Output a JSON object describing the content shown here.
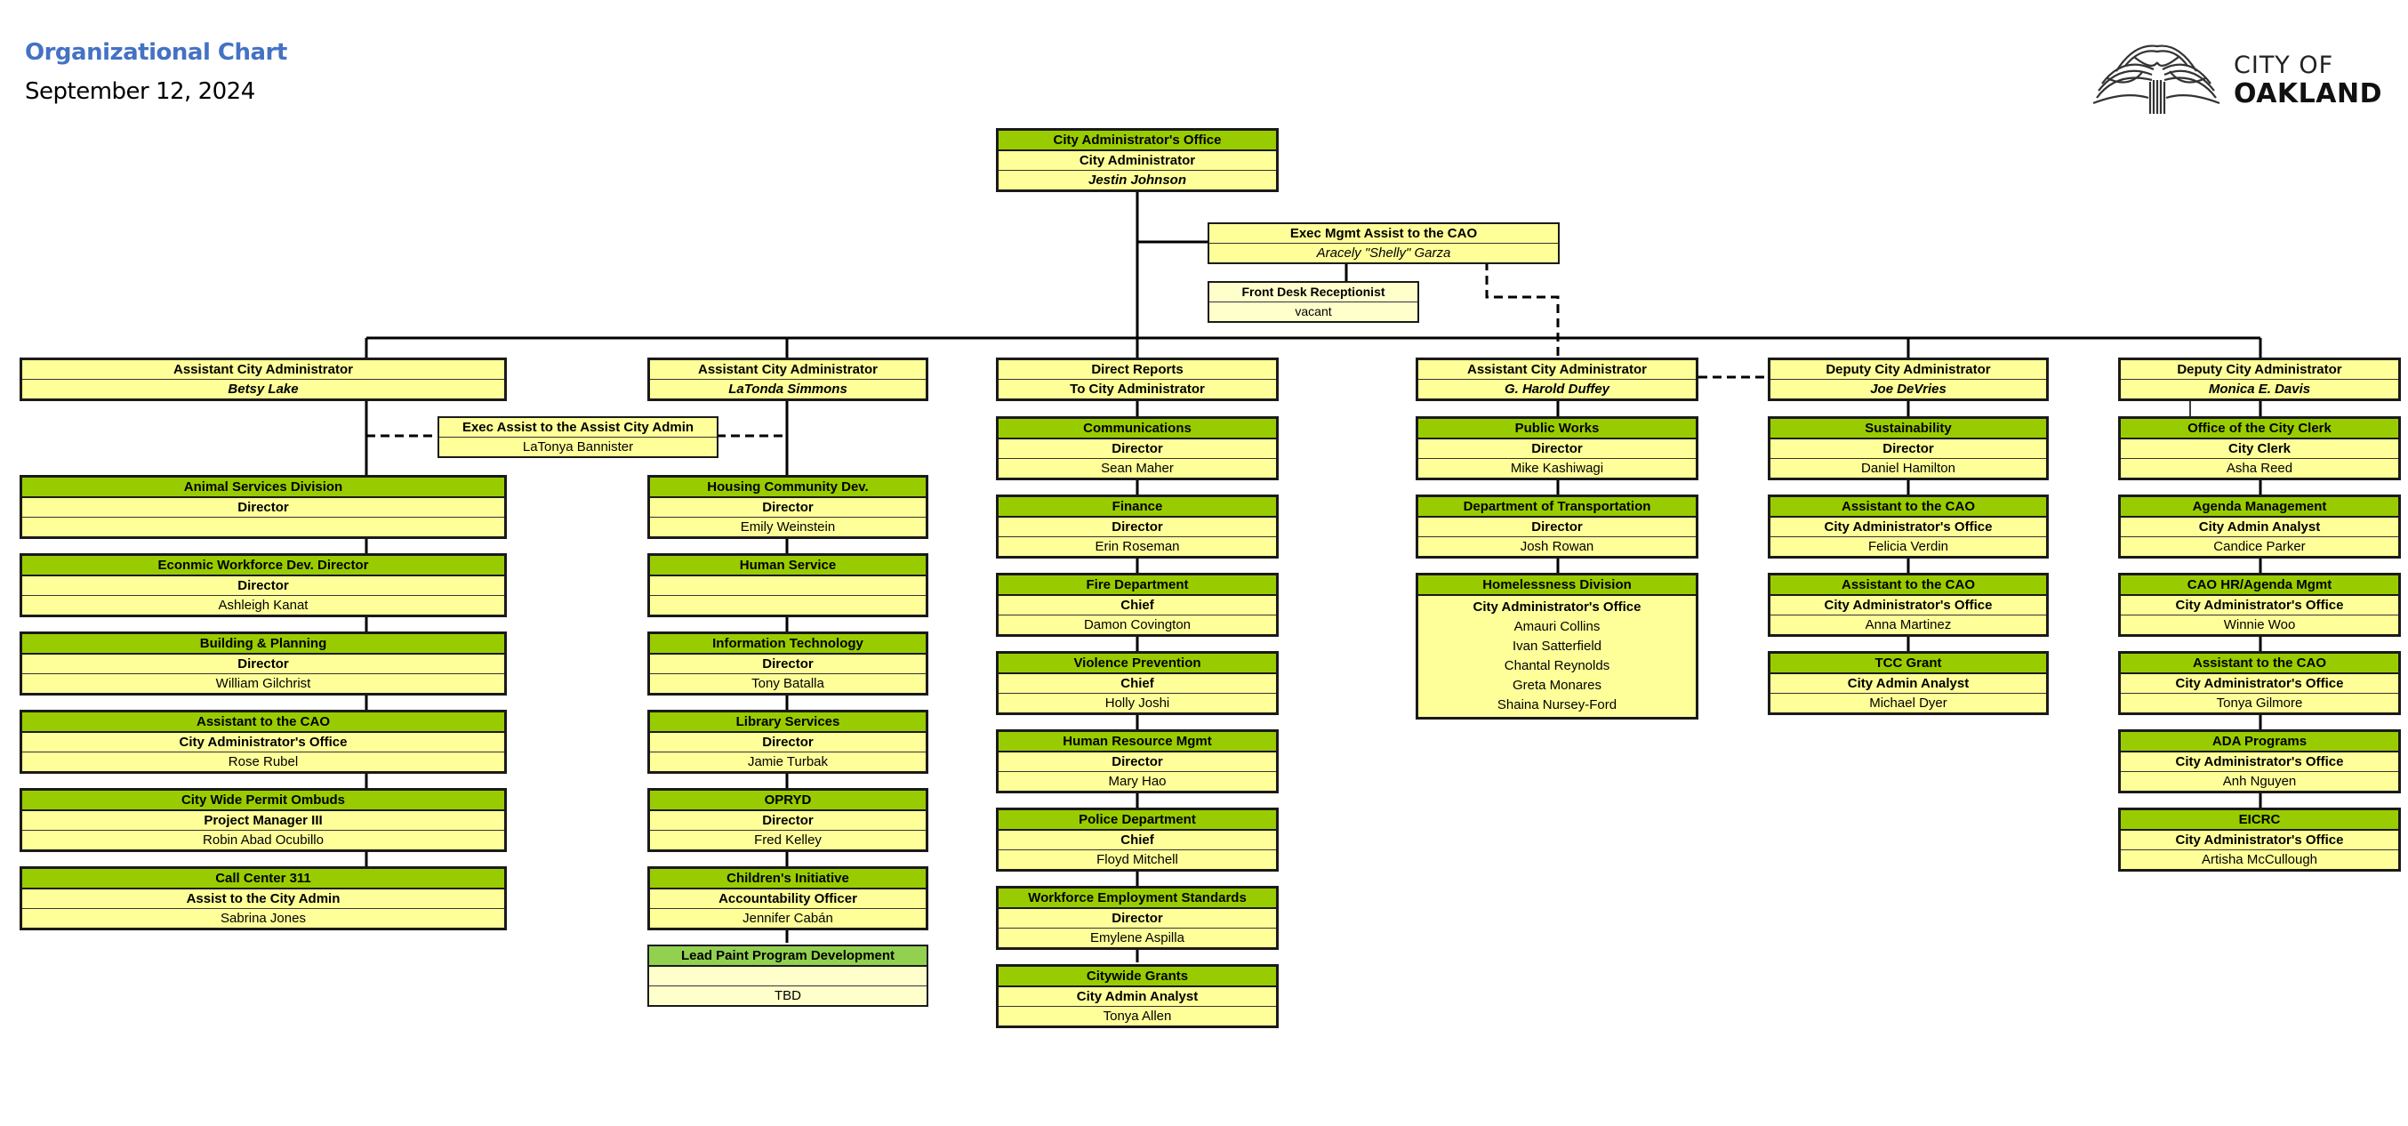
{
  "header": {
    "title": "Organizational Chart",
    "date": "September 12, 2024"
  },
  "logo": {
    "icon": "oak-tree-icon",
    "line1": "CITY OF",
    "line2": "OAKLAND"
  },
  "colors": {
    "title": "#4472c4",
    "dept_header": "#99cc00",
    "dept_header_light": "#92d050",
    "box_fill": "#ffff99",
    "box_fill_pale": "#ffffcc"
  },
  "top": {
    "office": "City Administrator's Office",
    "title": "City Administrator",
    "name": "Jestin Johnson"
  },
  "exec_assist": {
    "title": "Exec Mgmt Assist to the CAO",
    "name": "Aracely \"Shelly\" Garza"
  },
  "front_desk": {
    "title": "Front Desk Receptionist",
    "name": "vacant"
  },
  "exec_assist_aca": {
    "title": "Exec Assist to the Assist City Admin",
    "name": "LaTonya Bannister"
  },
  "columns": [
    {
      "lead": {
        "title": "Assistant City Administrator",
        "name": "Betsy Lake"
      },
      "units": [
        {
          "dept": "Animal Services Division",
          "role": "Director",
          "name": ""
        },
        {
          "dept": "Econmic Workforce Dev.  Director",
          "role": "Director",
          "name": "Ashleigh Kanat"
        },
        {
          "dept": "Building & Planning",
          "role": "Director",
          "name": "William Gilchrist"
        },
        {
          "dept": "Assistant to the CAO",
          "role": "City Administrator's Office",
          "name": "Rose Rubel"
        },
        {
          "dept": "City Wide Permit Ombuds",
          "role": "Project Manager III",
          "name": "Robin Abad Ocubillo"
        },
        {
          "dept": "Call Center 311",
          "role": "Assist to the City Admin",
          "name": "Sabrina Jones"
        }
      ]
    },
    {
      "lead": {
        "title": "Assistant City Administrator",
        "name": "LaTonda Simmons"
      },
      "units": [
        {
          "dept": "Housing Community Dev.",
          "role": "Director",
          "name": "Emily Weinstein"
        },
        {
          "dept": "Human Service",
          "role": "",
          "name": ""
        },
        {
          "dept": "Information Technology",
          "role": "Director",
          "name": "Tony Batalla"
        },
        {
          "dept": "Library Services",
          "role": "Director",
          "name": "Jamie Turbak"
        },
        {
          "dept": "OPRYD",
          "role": "Director",
          "name": "Fred Kelley"
        },
        {
          "dept": "Children's Initiative",
          "role": "Accountability Officer",
          "name": "Jennifer Cabán"
        },
        {
          "dept": "Lead Paint Program Development",
          "role": "",
          "name": "TBD"
        }
      ]
    },
    {
      "lead": {
        "title": "Direct Reports",
        "name": "To City Administrator"
      },
      "units": [
        {
          "dept": "Communications",
          "role": "Director",
          "name": "Sean Maher"
        },
        {
          "dept": "Finance",
          "role": "Director",
          "name": "Erin Roseman"
        },
        {
          "dept": "Fire  Department",
          "role": "Chief",
          "name": "Damon Covington"
        },
        {
          "dept": "Violence Prevention",
          "role": "Chief",
          "name": "Holly Joshi"
        },
        {
          "dept": "Human Resource Mgmt",
          "role": "Director",
          "name": "Mary Hao"
        },
        {
          "dept": "Police Department",
          "role": "Chief",
          "name": "Floyd Mitchell"
        },
        {
          "dept": "Workforce Employment Standards",
          "role": "Director",
          "name": "Emylene Aspilla"
        },
        {
          "dept": "Citywide Grants",
          "role": "City Admin Analyst",
          "name": "Tonya Allen"
        }
      ]
    },
    {
      "lead": {
        "title": "Assistant City Administrator",
        "name": "G. Harold Duffey"
      },
      "units": [
        {
          "dept": "Public Works",
          "role": "Director",
          "name": "Mike Kashiwagi"
        },
        {
          "dept": "Department of Transportation",
          "role": "Director",
          "name": "Josh Rowan"
        }
      ],
      "homelessness": {
        "dept": "Homelessness Division",
        "role": "City Administrator's Office",
        "names": [
          "Amauri Collins",
          "Ivan Satterfield",
          "Chantal Reynolds",
          "Greta Monares",
          "Shaina Nursey-Ford"
        ]
      }
    },
    {
      "lead": {
        "title": "Deputy City Administrator",
        "name": "Joe DeVries"
      },
      "units": [
        {
          "dept": "Sustainability",
          "role": "Director",
          "name": "Daniel Hamilton"
        },
        {
          "dept": "Assistant to the CAO",
          "role": "City Administrator's Office",
          "name": "Felicia Verdin"
        },
        {
          "dept": "Assistant to the CAO",
          "role": "City Administrator's Office",
          "name": "Anna Martinez"
        },
        {
          "dept": "TCC Grant",
          "role": "City Admin Analyst",
          "name": "Michael Dyer"
        }
      ]
    },
    {
      "lead": {
        "title": "Deputy City Administrator",
        "name": "Monica E. Davis"
      },
      "units": [
        {
          "dept": "Office of the City Clerk",
          "role": "City Clerk",
          "name": "Asha Reed"
        },
        {
          "dept": "Agenda Management",
          "role": "City Admin Analyst",
          "name": "Candice Parker"
        },
        {
          "dept": "CAO HR/Agenda Mgmt",
          "role": "City Administrator's Office",
          "name": "Winnie Woo"
        },
        {
          "dept": "Assistant to the CAO",
          "role": "City Administrator's Office",
          "name": "Tonya Gilmore"
        },
        {
          "dept": "ADA Programs",
          "role": "City Administrator's Office",
          "name": "Anh Nguyen"
        },
        {
          "dept": "EICRC",
          "role": "City Administrator's Office",
          "name": "Artisha McCullough"
        }
      ]
    }
  ]
}
